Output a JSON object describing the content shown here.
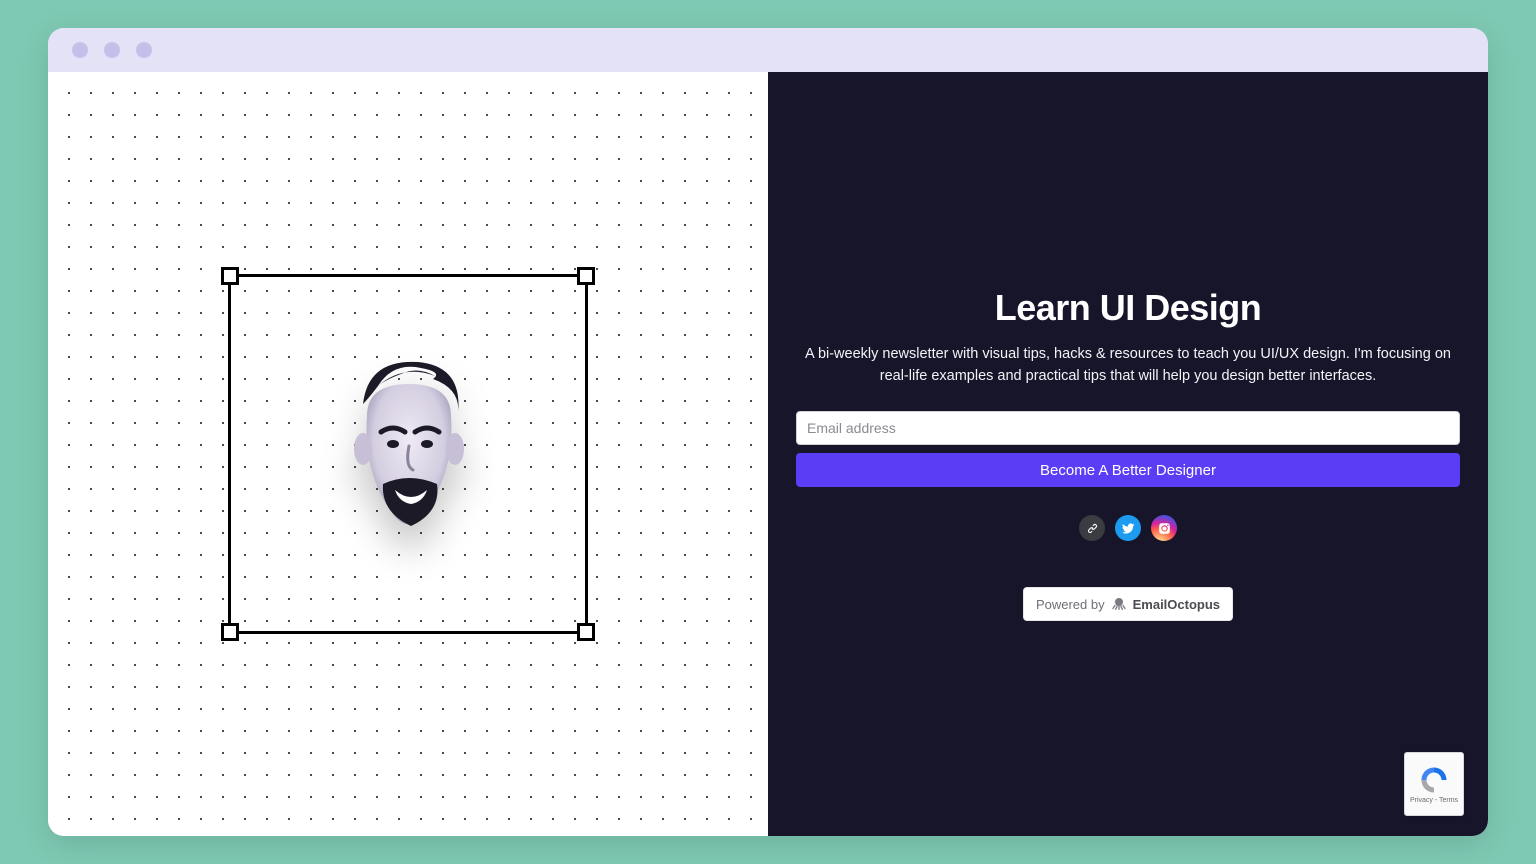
{
  "hero": {
    "title": "Learn UI Design",
    "subtitle": "A bi-weekly newsletter with visual tips, hacks & resources to teach you UI/UX design. I'm focusing on real-life examples and practical tips that will help you design better interfaces.",
    "email_placeholder": "Email address",
    "submit_label": "Become A Better Designer"
  },
  "social": {
    "link_name": "link",
    "twitter_name": "twitter",
    "instagram_name": "instagram"
  },
  "powered": {
    "prefix": "Powered by",
    "brand": "EmailOctopus"
  },
  "recaptcha": {
    "line": "Privacy - Terms"
  },
  "colors": {
    "dark_panel": "#17152a",
    "accent": "#5b3df5",
    "chrome": "#e4e2f7"
  }
}
